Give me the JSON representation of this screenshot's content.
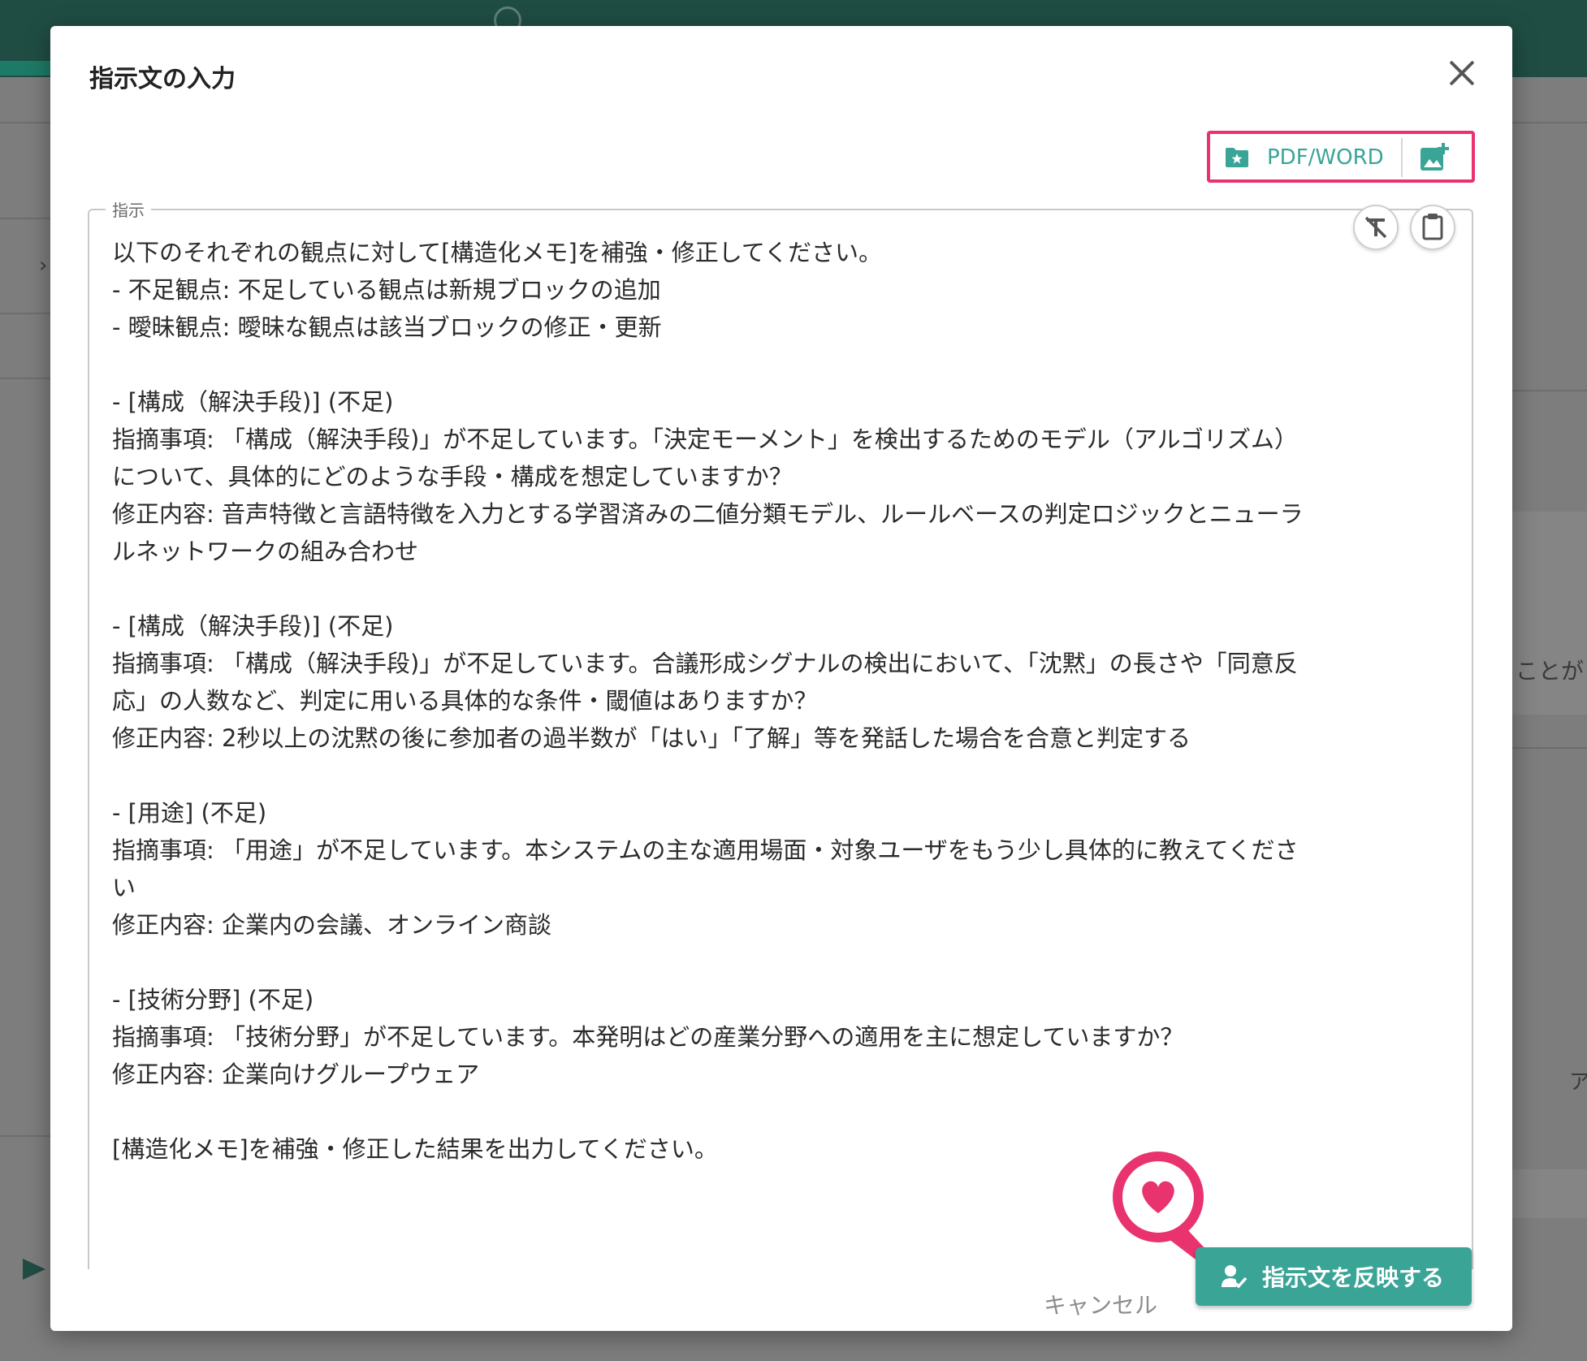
{
  "background": {
    "side_text_1": "ことが",
    "side_text_2": "ア",
    "breadcrumb_chevron": "›"
  },
  "dialog": {
    "title": "指示文の入力",
    "toolbar": {
      "pdf_word_label": "PDF/WORD"
    },
    "instruction": {
      "legend": "指示",
      "text": "以下のそれぞれの観点に対して[構造化メモ]を補強・修正してください。\n- 不足観点: 不足している観点は新規ブロックの追加\n- 曖昧観点: 曖昧な観点は該当ブロックの修正・更新\n\n- [構成（解決手段)] (不足)\n指摘事項: 「構成（解決手段)」が不足しています。「決定モーメント」を検出するためのモデル（アルゴリズム）\nについて、具体的にどのような手段・構成を想定していますか？\n修正内容: 音声特徴と言語特徴を入力とする学習済みの二値分類モデル、ルールベースの判定ロジックとニューラ\nルネットワークの組み合わせ\n\n- [構成（解決手段)] (不足)\n指摘事項: 「構成（解決手段)」が不足しています。合議形成シグナルの検出において、「沈黙」の長さや「同意反\n応」の人数など、判定に用いる具体的な条件・閾値はありますか？\n修正内容: 2秒以上の沈黙の後に参加者の過半数が「はい」「了解」等を発話した場合を合意と判定する\n\n- [用途] (不足)\n指摘事項: 「用途」が不足しています。本システムの主な適用場面・対象ユーザをもう少し具体的に教えてくださ\nい\n修正内容: 企業内の会議、オンライン商談\n\n- [技術分野] (不足)\n指摘事項: 「技術分野」が不足しています。本発明はどの産業分野への適用を主に想定していますか？\n修正内容: 企業向けグループウェア\n\n[構造化メモ]を補強・修正した結果を出力してください。"
    },
    "footer": {
      "cancel_label": "キャンセル",
      "apply_label": "指示文を反映する"
    }
  },
  "colors": {
    "accent": "#3aa597",
    "highlight": "#e8336f",
    "header_bg": "#1f4d44"
  },
  "icons": {
    "close": "close-icon",
    "folder": "folder-star-icon",
    "image_add": "image-add-icon",
    "clear_format": "clear-format-icon",
    "clipboard": "clipboard-icon",
    "user_check": "user-check-icon",
    "heart": "heart-icon",
    "send": "send-icon"
  }
}
